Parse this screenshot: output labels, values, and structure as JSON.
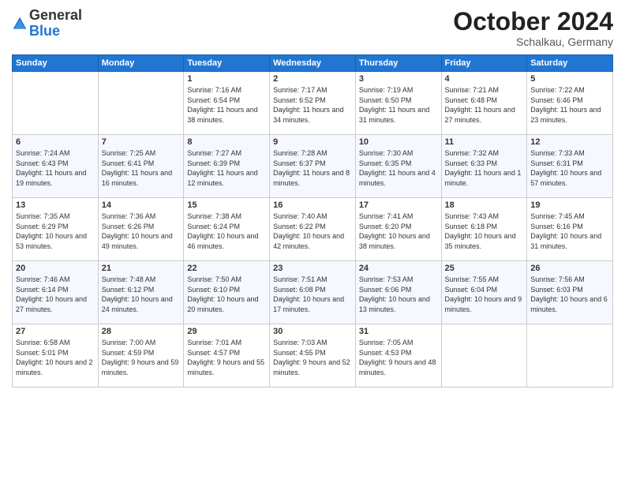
{
  "logo": {
    "general": "General",
    "blue": "Blue"
  },
  "header": {
    "month": "October 2024",
    "location": "Schalkau, Germany"
  },
  "weekdays": [
    "Sunday",
    "Monday",
    "Tuesday",
    "Wednesday",
    "Thursday",
    "Friday",
    "Saturday"
  ],
  "weeks": [
    [
      {
        "day": "",
        "sunrise": "",
        "sunset": "",
        "daylight": "",
        "empty": true
      },
      {
        "day": "",
        "sunrise": "",
        "sunset": "",
        "daylight": "",
        "empty": true
      },
      {
        "day": "1",
        "sunrise": "Sunrise: 7:16 AM",
        "sunset": "Sunset: 6:54 PM",
        "daylight": "Daylight: 11 hours and 38 minutes."
      },
      {
        "day": "2",
        "sunrise": "Sunrise: 7:17 AM",
        "sunset": "Sunset: 6:52 PM",
        "daylight": "Daylight: 11 hours and 34 minutes."
      },
      {
        "day": "3",
        "sunrise": "Sunrise: 7:19 AM",
        "sunset": "Sunset: 6:50 PM",
        "daylight": "Daylight: 11 hours and 31 minutes."
      },
      {
        "day": "4",
        "sunrise": "Sunrise: 7:21 AM",
        "sunset": "Sunset: 6:48 PM",
        "daylight": "Daylight: 11 hours and 27 minutes."
      },
      {
        "day": "5",
        "sunrise": "Sunrise: 7:22 AM",
        "sunset": "Sunset: 6:46 PM",
        "daylight": "Daylight: 11 hours and 23 minutes."
      }
    ],
    [
      {
        "day": "6",
        "sunrise": "Sunrise: 7:24 AM",
        "sunset": "Sunset: 6:43 PM",
        "daylight": "Daylight: 11 hours and 19 minutes."
      },
      {
        "day": "7",
        "sunrise": "Sunrise: 7:25 AM",
        "sunset": "Sunset: 6:41 PM",
        "daylight": "Daylight: 11 hours and 16 minutes."
      },
      {
        "day": "8",
        "sunrise": "Sunrise: 7:27 AM",
        "sunset": "Sunset: 6:39 PM",
        "daylight": "Daylight: 11 hours and 12 minutes."
      },
      {
        "day": "9",
        "sunrise": "Sunrise: 7:28 AM",
        "sunset": "Sunset: 6:37 PM",
        "daylight": "Daylight: 11 hours and 8 minutes."
      },
      {
        "day": "10",
        "sunrise": "Sunrise: 7:30 AM",
        "sunset": "Sunset: 6:35 PM",
        "daylight": "Daylight: 11 hours and 4 minutes."
      },
      {
        "day": "11",
        "sunrise": "Sunrise: 7:32 AM",
        "sunset": "Sunset: 6:33 PM",
        "daylight": "Daylight: 11 hours and 1 minute."
      },
      {
        "day": "12",
        "sunrise": "Sunrise: 7:33 AM",
        "sunset": "Sunset: 6:31 PM",
        "daylight": "Daylight: 10 hours and 57 minutes."
      }
    ],
    [
      {
        "day": "13",
        "sunrise": "Sunrise: 7:35 AM",
        "sunset": "Sunset: 6:29 PM",
        "daylight": "Daylight: 10 hours and 53 minutes."
      },
      {
        "day": "14",
        "sunrise": "Sunrise: 7:36 AM",
        "sunset": "Sunset: 6:26 PM",
        "daylight": "Daylight: 10 hours and 49 minutes."
      },
      {
        "day": "15",
        "sunrise": "Sunrise: 7:38 AM",
        "sunset": "Sunset: 6:24 PM",
        "daylight": "Daylight: 10 hours and 46 minutes."
      },
      {
        "day": "16",
        "sunrise": "Sunrise: 7:40 AM",
        "sunset": "Sunset: 6:22 PM",
        "daylight": "Daylight: 10 hours and 42 minutes."
      },
      {
        "day": "17",
        "sunrise": "Sunrise: 7:41 AM",
        "sunset": "Sunset: 6:20 PM",
        "daylight": "Daylight: 10 hours and 38 minutes."
      },
      {
        "day": "18",
        "sunrise": "Sunrise: 7:43 AM",
        "sunset": "Sunset: 6:18 PM",
        "daylight": "Daylight: 10 hours and 35 minutes."
      },
      {
        "day": "19",
        "sunrise": "Sunrise: 7:45 AM",
        "sunset": "Sunset: 6:16 PM",
        "daylight": "Daylight: 10 hours and 31 minutes."
      }
    ],
    [
      {
        "day": "20",
        "sunrise": "Sunrise: 7:46 AM",
        "sunset": "Sunset: 6:14 PM",
        "daylight": "Daylight: 10 hours and 27 minutes."
      },
      {
        "day": "21",
        "sunrise": "Sunrise: 7:48 AM",
        "sunset": "Sunset: 6:12 PM",
        "daylight": "Daylight: 10 hours and 24 minutes."
      },
      {
        "day": "22",
        "sunrise": "Sunrise: 7:50 AM",
        "sunset": "Sunset: 6:10 PM",
        "daylight": "Daylight: 10 hours and 20 minutes."
      },
      {
        "day": "23",
        "sunrise": "Sunrise: 7:51 AM",
        "sunset": "Sunset: 6:08 PM",
        "daylight": "Daylight: 10 hours and 17 minutes."
      },
      {
        "day": "24",
        "sunrise": "Sunrise: 7:53 AM",
        "sunset": "Sunset: 6:06 PM",
        "daylight": "Daylight: 10 hours and 13 minutes."
      },
      {
        "day": "25",
        "sunrise": "Sunrise: 7:55 AM",
        "sunset": "Sunset: 6:04 PM",
        "daylight": "Daylight: 10 hours and 9 minutes."
      },
      {
        "day": "26",
        "sunrise": "Sunrise: 7:56 AM",
        "sunset": "Sunset: 6:03 PM",
        "daylight": "Daylight: 10 hours and 6 minutes."
      }
    ],
    [
      {
        "day": "27",
        "sunrise": "Sunrise: 6:58 AM",
        "sunset": "Sunset: 5:01 PM",
        "daylight": "Daylight: 10 hours and 2 minutes."
      },
      {
        "day": "28",
        "sunrise": "Sunrise: 7:00 AM",
        "sunset": "Sunset: 4:59 PM",
        "daylight": "Daylight: 9 hours and 59 minutes."
      },
      {
        "day": "29",
        "sunrise": "Sunrise: 7:01 AM",
        "sunset": "Sunset: 4:57 PM",
        "daylight": "Daylight: 9 hours and 55 minutes."
      },
      {
        "day": "30",
        "sunrise": "Sunrise: 7:03 AM",
        "sunset": "Sunset: 4:55 PM",
        "daylight": "Daylight: 9 hours and 52 minutes."
      },
      {
        "day": "31",
        "sunrise": "Sunrise: 7:05 AM",
        "sunset": "Sunset: 4:53 PM",
        "daylight": "Daylight: 9 hours and 48 minutes."
      },
      {
        "day": "",
        "sunrise": "",
        "sunset": "",
        "daylight": "",
        "empty": true
      },
      {
        "day": "",
        "sunrise": "",
        "sunset": "",
        "daylight": "",
        "empty": true
      }
    ]
  ]
}
